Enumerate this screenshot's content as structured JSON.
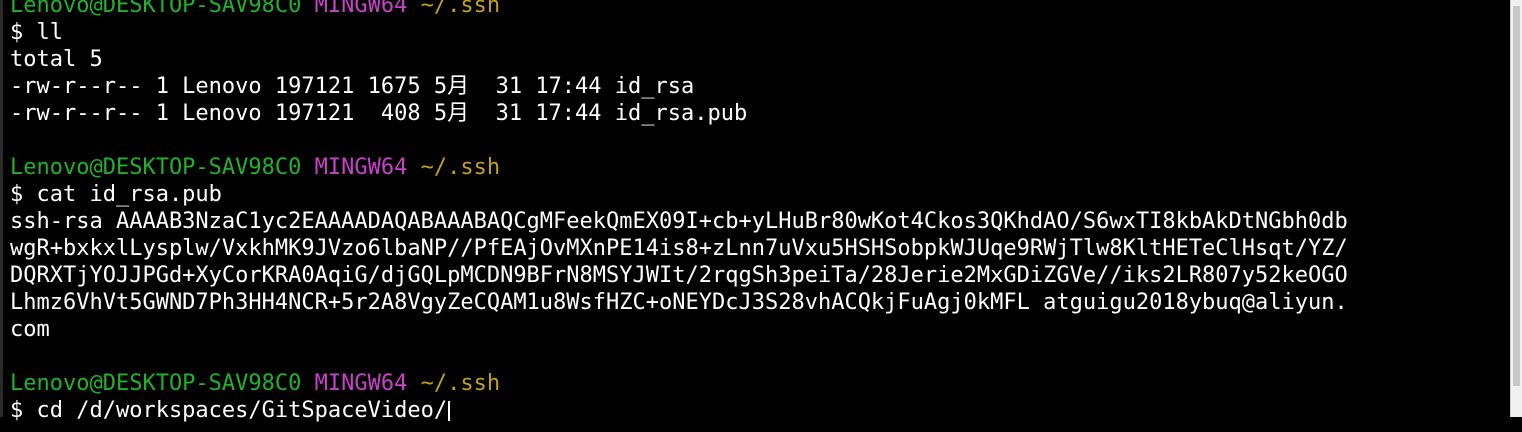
{
  "prompt": {
    "user_host": "Lenovo@DESKTOP-SAV98C0",
    "system": "MINGW64",
    "cwd": "~/.ssh"
  },
  "commands": {
    "cmd1": "$ ll",
    "cmd2": "$ cat id_rsa.pub",
    "cmd3": "$ cd /d/workspaces/GitSpaceVideo/"
  },
  "ll_output": [
    "total 5",
    "-rw-r--r-- 1 Lenovo 197121 1675 5月  31 17:44 id_rsa",
    "-rw-r--r-- 1 Lenovo 197121  408 5月  31 17:44 id_rsa.pub"
  ],
  "cat_output": [
    "ssh-rsa AAAAB3NzaC1yc2EAAAADAQABAAABAQCgMFeekQmEX09I+cb+yLHuBr80wKot4Ckos3QKhdAO/S6wxTI8kbAkDtNGbh0db",
    "wgR+bxkxlLysplw/VxkhMK9JVzo6lbaNP//PfEAjOvMXnPE14is8+zLnn7uVxu5HSHSobpkWJUqe9RWjTlw8KltHETeClHsqt/YZ/",
    "DQRXTjYOJJPGd+XyCorKRA0AqiG/djGQLpMCDN9BFrN8MSYJWIt/2rqgSh3peiTa/28Jerie2MxGDiZGVe//iks2LR807y52keOGO",
    "Lhmz6VhVt5GWND7Ph3HH4NCR+5r2A8VgyZeCQAM1u8WsfHZC+oNEYDcJ3S28vhACQkjFuAgj0kMFL atguigu2018ybuq@aliyun.",
    "com"
  ]
}
